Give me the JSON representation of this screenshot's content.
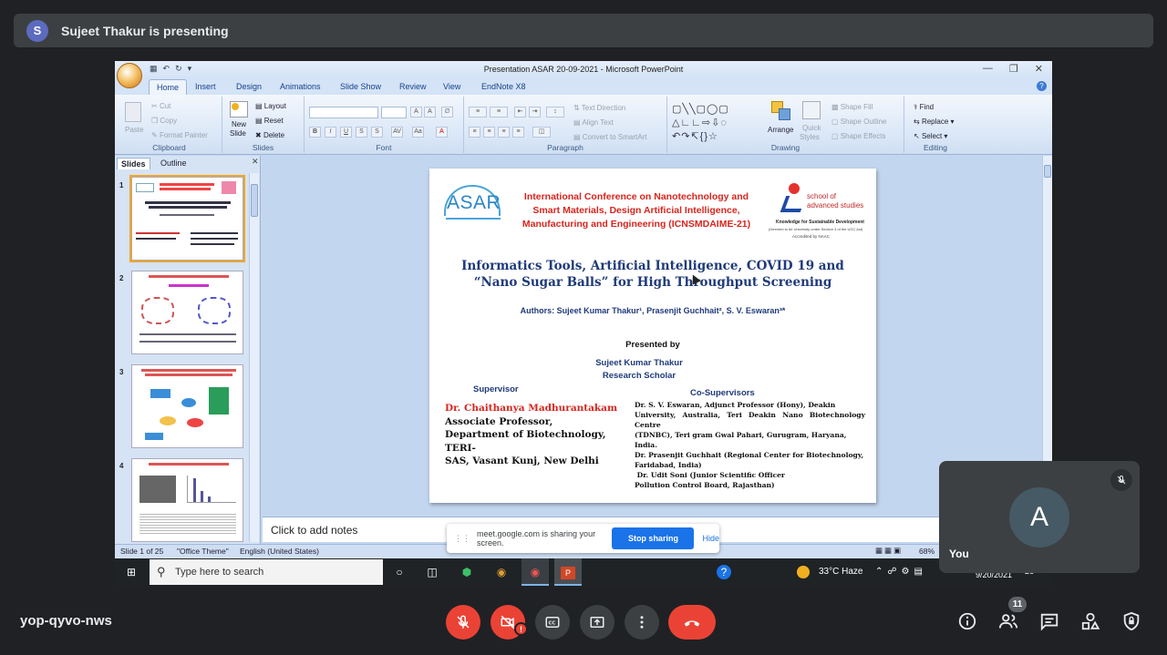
{
  "presenter": {
    "initial": "S",
    "text": "Sujeet Thakur is presenting"
  },
  "window": {
    "title": "Presentation ASAR  20-09-2021 - Microsoft PowerPoint",
    "tabs": [
      "Home",
      "Insert",
      "Design",
      "Animations",
      "Slide Show",
      "Review",
      "View",
      "EndNote X8"
    ],
    "active_tab": "Home"
  },
  "ribbon": {
    "clipboard": {
      "label": "Clipboard",
      "paste": "Paste",
      "cut": "Cut",
      "copy": "Copy",
      "format_painter": "Format Painter"
    },
    "slides": {
      "label": "Slides",
      "new_slide": "New",
      "new_slide2": "Slide",
      "layout": "Layout",
      "reset": "Reset",
      "delete": "Delete"
    },
    "font": {
      "label": "Font"
    },
    "paragraph": {
      "label": "Paragraph",
      "text_direction": "Text Direction",
      "align_text": "Align Text",
      "convert": "Convert to SmartArt"
    },
    "drawing": {
      "label": "Drawing",
      "arrange": "Arrange",
      "quick_styles": "Quick",
      "quick_styles2": "Styles",
      "shape_fill": "Shape Fill",
      "shape_outline": "Shape Outline",
      "shape_effects": "Shape Effects"
    },
    "editing": {
      "label": "Editing",
      "find": "Find",
      "replace": "Replace",
      "select": "Select"
    }
  },
  "slide_pane": {
    "tab_slides": "Slides",
    "tab_outline": "Outline",
    "numbers": [
      "1",
      "2",
      "3",
      "4"
    ]
  },
  "slide": {
    "logo": "ASAR",
    "conference": [
      "International Conference on Nanotechnology and",
      "Smart Materials, Design Artificial Intelligence,",
      "Manufacturing and Engineering (ICNSMDAIME-21)"
    ],
    "uni_line1": "school of",
    "uni_line2": "advanced studies",
    "uni_tag": "Knowledge for Sustainable Development",
    "uni_note": "(Deemed to be University under Section 3 of the UGC Act)",
    "uni_accr": "Accredited by NAAC",
    "title1": "Informatics Tools, Artificial Intelligence, COVID 19 and",
    "title2": "“Nano Sugar Balls” for  High Throughput Screening",
    "authors": "Authors: Sujeet Kumar Thakur¹, Prasenjit Guchhait², S. V. Eswaran³*",
    "presented_by": "Presented by",
    "presenter_name": "Sujeet Kumar Thakur",
    "presenter_role": "Research Scholar",
    "supervisor_heading": "Supervisor",
    "supervisor_name": "Dr. Chaithanya Madhurantakam",
    "supervisor_lines": [
      "Associate Professor,",
      "Department of Biotechnology, TERI-",
      "SAS, Vasant Kunj, New Delhi"
    ],
    "cosup_heading": "Co-Supervisors",
    "cosup_lines": [
      "Dr. S. V. Eswaran, Adjunct Professor (Hony), Deakin",
      "University, Australia, Teri Deakin Nano Biotechnology Centre",
      "(TDNBC), Teri gram Gwal Pahari,  Gurugram, Haryana,",
      "India.",
      "Dr. Prasenjit Guchhait (Regional Center for Biotechnology,",
      "Faridabad, India)",
      " Dr. Udit Soni (Junior Scientific Officer",
      "Pollution Control Board, Rajasthan)"
    ]
  },
  "notes_placeholder": "Click to add notes",
  "status": {
    "slide": "Slide 1 of 25",
    "theme": "\"Office Theme\"",
    "language": "English (United States)",
    "zoom": "68%"
  },
  "taskbar": {
    "search": "Type here to search",
    "weather": "33°C  Haze",
    "date": "9/20/2021",
    "notify": "26"
  },
  "share_banner": {
    "text": "meet.google.com is sharing your screen.",
    "stop": "Stop sharing",
    "hide": "Hide"
  },
  "self_tile": {
    "initial": "A",
    "name": "You"
  },
  "meeting": {
    "code": "yop-qyvo-nws",
    "participants": "11",
    "warning": "!"
  },
  "colors": {
    "end_call": "#ea4335",
    "accent": "#1a73e8",
    "background": "#202124"
  }
}
